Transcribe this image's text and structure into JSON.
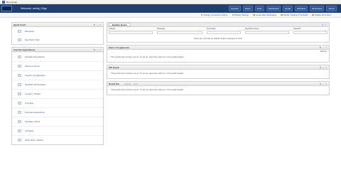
{
  "window": {
    "title": "Run Center"
  },
  "topbar": {
    "user": "Welcome, amiraj | Sign",
    "nav": [
      "Reports",
      "Setup",
      "Tools",
      "Dashboard",
      "Email",
      "Workflow",
      "Resources",
      "Admin"
    ]
  },
  "subbar": {
    "links": [
      "Change Connection Source",
      "Display Settings",
      "Create New Workspace",
      "Identity Tracking Thresholds",
      "Update All Portlets"
    ]
  },
  "quick_insert": {
    "title": "Quick Insert",
    "items": [
      "New Asset",
      "New Work Order"
    ]
  },
  "favorite_apps": {
    "title": "Favorite Applications",
    "items": [
      "Purchase Requisitions",
      "Storeroom Items",
      "Inventory Configuration",
      "Workflow Administration",
      "Inventory Transfer",
      "Contracts",
      "Purchase Requisitions",
      "Purchase Orders",
      "Job Plans",
      "Work Order Tracking"
    ]
  },
  "bulletin": {
    "tab": "Bulletin Board",
    "columns": [
      "Subject",
      "Message",
      "Post Date",
      "Expiration Date",
      "Viewed?"
    ],
    "empty_message": "There are currently no bulletin board messages to view."
  },
  "portlet_inbox": {
    "title": "Inbox / Assignments",
    "refresh": "Refresh",
    "message": "This portlet has not been set up. To set up, select the edit icon  in the portlet header."
  },
  "portlet_kpi": {
    "title": "KPI Graph",
    "message": "This portlet has not been set up. To set up, select the edit icon  in the portlet header."
  },
  "portlet_result": {
    "title": "Result Set",
    "tabs": [
      "Assets",
      "Locs"
    ],
    "message": "This portlet has not been set up. To set up, select the edit icon  in the portlet header."
  },
  "colors": {
    "brand": "#1f3f70",
    "link": "#3a5a8c"
  }
}
